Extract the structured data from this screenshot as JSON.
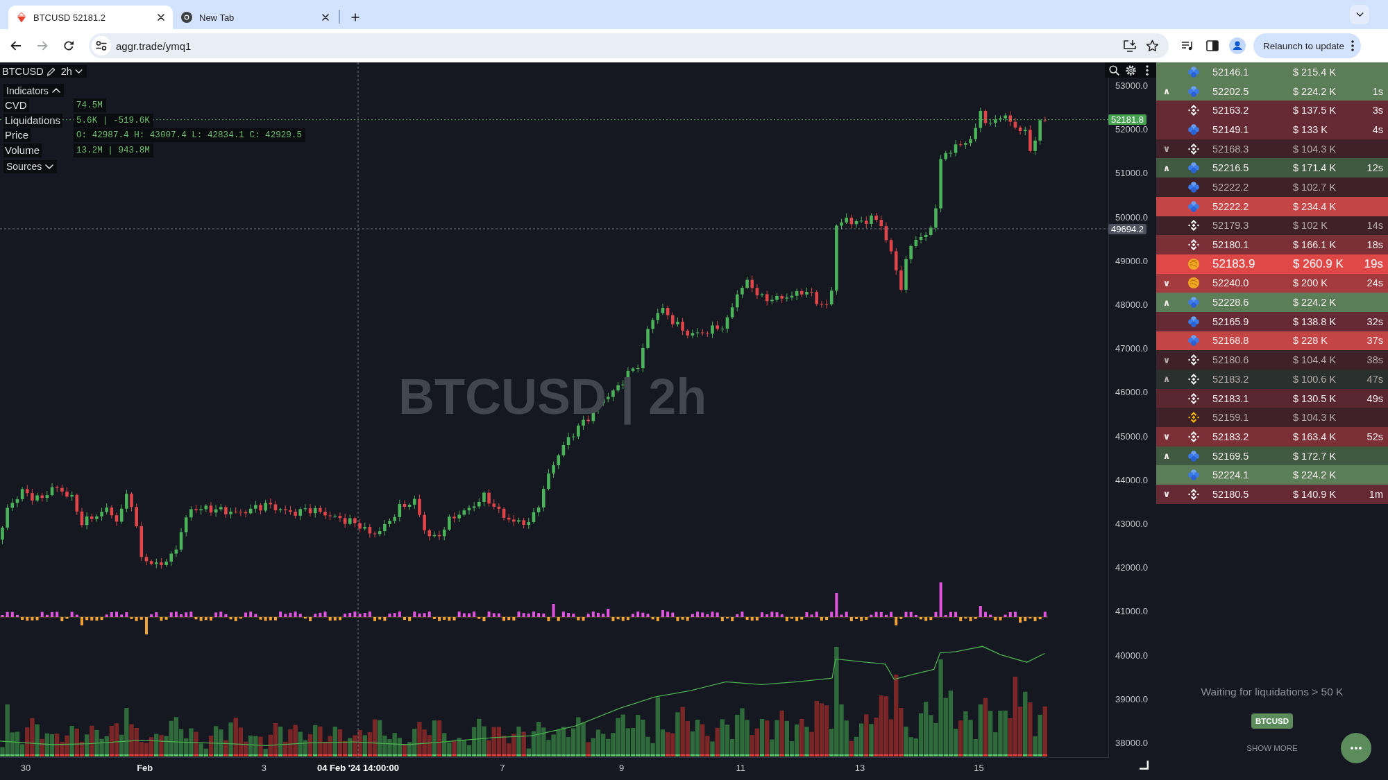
{
  "browser": {
    "tabs": [
      {
        "title": "BTCUSD 52181.2",
        "kind": "app",
        "selected": true
      },
      {
        "title": "New Tab",
        "kind": "newtab",
        "selected": false
      }
    ],
    "nav_buttons": [
      {
        "kind": "back",
        "disabled": false
      },
      {
        "kind": "forward",
        "disabled": true
      },
      {
        "kind": "reload",
        "disabled": false
      }
    ],
    "address_bar": {
      "url": "aggr.trade/ymq1"
    },
    "relaunch_button": {
      "label": "Relaunch to update"
    }
  },
  "chart": {
    "market": {
      "symbol": "BTCUSD",
      "timeframe": "2h"
    },
    "indicators_toggle": {
      "label": "Indicators",
      "expanded": true
    },
    "indicators": [
      {
        "name": "CVD",
        "value": "74.5M"
      },
      {
        "name": "Liquidations",
        "value": "5.6K | -519.6K"
      },
      {
        "name": "Price",
        "value": "O: 42987.4 H: 43007.4 L: 42834.1 C: 42929.5"
      },
      {
        "name": "Volume",
        "value": "13.2M | 943.8M"
      }
    ],
    "sources_toggle": {
      "label": "Sources",
      "expanded": false
    },
    "chart_label": "BTCUSD | 2h",
    "price_axis": {
      "ticks": [
        "53000.0",
        "52000.0",
        "51000.0",
        "50000.0",
        "49000.0",
        "48000.0",
        "47000.0",
        "46000.0",
        "45000.0",
        "44000.0",
        "43000.0",
        "42000.0",
        "41000.0",
        "40000.0",
        "39000.0",
        "38000.0"
      ],
      "last_price": "52181.8",
      "crosshair_price": "49694.2"
    },
    "time_axis": {
      "labels": [
        {
          "text": "30",
          "kind": "day"
        },
        {
          "text": "Feb",
          "kind": "month"
        },
        {
          "text": "3",
          "kind": "day"
        },
        {
          "text": "04 Feb '24 14:00:00",
          "kind": "crosshair"
        },
        {
          "text": "7",
          "kind": "day"
        },
        {
          "text": "9",
          "kind": "day"
        },
        {
          "text": "11",
          "kind": "day"
        },
        {
          "text": "13",
          "kind": "day"
        },
        {
          "text": "15",
          "kind": "day"
        }
      ]
    }
  },
  "trades": [
    {
      "kind": "circles",
      "price": "52146.1",
      "amount": "$ 215.4 K",
      "color": "#5b7d58",
      "dimmed": false,
      "large": false
    },
    {
      "marker": "∧",
      "kind": "circles",
      "price": "52202.5",
      "amount": "$ 224.2 K",
      "time": "1s",
      "color": "#5b7d58",
      "dimmed": false,
      "large": false
    },
    {
      "kind": "diamond",
      "price": "52163.2",
      "amount": "$ 137.5 K",
      "time": "3s",
      "color": "#652a33",
      "dimmed": false,
      "large": false
    },
    {
      "kind": "circles",
      "price": "52149.1",
      "amount": "$ 133 K",
      "time": "4s",
      "color": "#652a33",
      "dimmed": false,
      "large": false
    },
    {
      "marker": "∨",
      "kind": "diamond",
      "price": "52168.3",
      "amount": "$ 104.3 K",
      "color": "#3f2229",
      "dimmed": true,
      "large": false
    },
    {
      "marker": "∧",
      "kind": "circles",
      "price": "52216.5",
      "amount": "$ 171.4 K",
      "time": "12s",
      "color": "#3f5a41",
      "dimmed": false,
      "large": false
    },
    {
      "kind": "circles",
      "price": "52222.2",
      "amount": "$ 102.7 K",
      "color": "#3f2229",
      "dimmed": true,
      "large": false
    },
    {
      "kind": "circles",
      "price": "52222.2",
      "amount": "$ 234.4 K",
      "color": "#c54445",
      "dimmed": false,
      "large": false
    },
    {
      "kind": "diamond",
      "price": "52179.3",
      "amount": "$ 102 K",
      "time": "14s",
      "color": "#3f2229",
      "dimmed": true,
      "large": false
    },
    {
      "kind": "diamond",
      "price": "52180.1",
      "amount": "$ 166.1 K",
      "time": "18s",
      "color": "#7a3036",
      "dimmed": false,
      "large": false
    },
    {
      "kind": "swirl",
      "price": "52183.9",
      "amount": "$ 260.9 K",
      "time": "19s",
      "color": "#e04848",
      "dimmed": false,
      "large": true
    },
    {
      "marker": "∨",
      "kind": "swirl",
      "price": "52240.0",
      "amount": "$ 200 K",
      "time": "24s",
      "color": "#a33a3d",
      "dimmed": false,
      "large": false
    },
    {
      "marker": "∧",
      "kind": "circles",
      "price": "52228.6",
      "amount": "$ 224.2 K",
      "color": "#5b7d58",
      "dimmed": false,
      "large": false
    },
    {
      "kind": "circles",
      "price": "52165.9",
      "amount": "$ 138.8 K",
      "time": "32s",
      "color": "#652a33",
      "dimmed": false,
      "large": false
    },
    {
      "kind": "circles",
      "price": "52168.8",
      "amount": "$ 228 K",
      "time": "37s",
      "color": "#c54445",
      "dimmed": false,
      "large": false
    },
    {
      "marker": "∨",
      "kind": "diamond",
      "price": "52180.6",
      "amount": "$ 104.4 K",
      "time": "38s",
      "color": "#3f2229",
      "dimmed": true,
      "large": false
    },
    {
      "marker": "∧",
      "kind": "diamond",
      "price": "52183.2",
      "amount": "$ 100.6 K",
      "time": "47s",
      "color": "#2a302d",
      "dimmed": true,
      "large": false
    },
    {
      "kind": "diamond",
      "price": "52183.1",
      "amount": "$ 130.5 K",
      "time": "49s",
      "color": "#5a2630",
      "dimmed": false,
      "large": false
    },
    {
      "kind": "golddiamond",
      "price": "52159.1",
      "amount": "$ 104.3 K",
      "color": "#3f2229",
      "dimmed": true,
      "large": false
    },
    {
      "marker": "∨",
      "kind": "diamond",
      "price": "52183.2",
      "amount": "$ 163.4 K",
      "time": "52s",
      "color": "#7a3036",
      "dimmed": false,
      "large": false
    },
    {
      "marker": "∧",
      "kind": "circles",
      "price": "52169.5",
      "amount": "$ 172.7 K",
      "color": "#3f5a41",
      "dimmed": false,
      "large": false
    },
    {
      "kind": "circles",
      "price": "52224.1",
      "amount": "$ 224.2 K",
      "color": "#5b7d58",
      "dimmed": false,
      "large": false
    },
    {
      "marker": "∨",
      "kind": "diamond",
      "price": "52180.5",
      "amount": "$ 140.9 K",
      "time": "1m",
      "color": "#652a33",
      "dimmed": false,
      "large": false
    }
  ],
  "liquidations": {
    "status": "Waiting for liquidations > 50 K",
    "market_tag": "BTCUSD",
    "show_more": "SHOW MORE"
  }
}
